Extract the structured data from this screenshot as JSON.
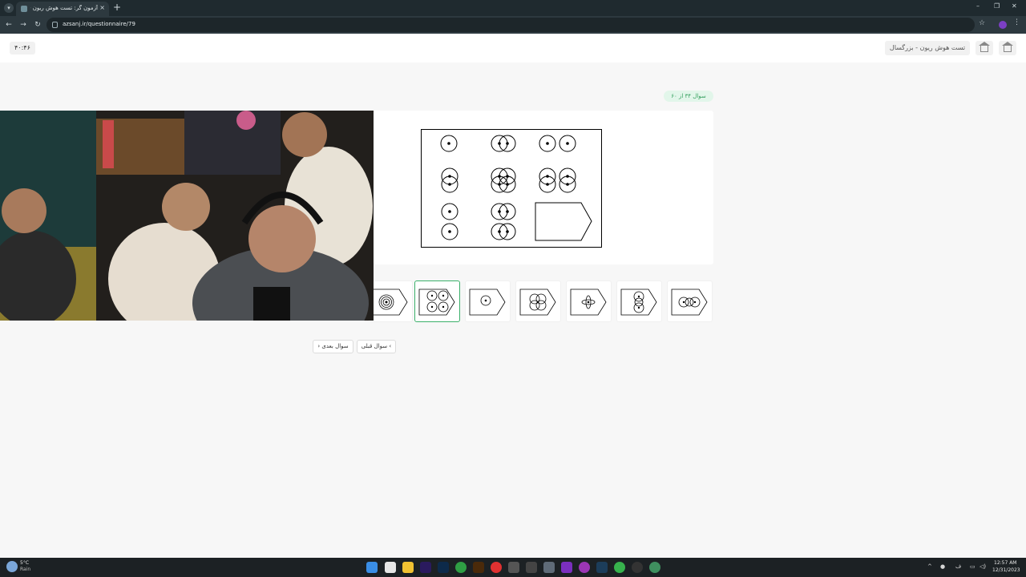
{
  "browser": {
    "tab_title": "آزمون گر: تست هوش ریون - بزرگسال",
    "tab_close": "×",
    "new_tab": "+",
    "url": "azsanj.ir/questionnaire/79",
    "minimize": "–",
    "restore": "❐",
    "close": "✕"
  },
  "header": {
    "timer": "۴۰:۴۶",
    "test_title": "تست هوش ریون - بزرگسال"
  },
  "question": {
    "progress": "سوال ۳۴ از ۶۰"
  },
  "navigation": {
    "next_label": "سوال بعدی",
    "prev_label": "سوال قبلی"
  },
  "options": {
    "selected_index": 1
  },
  "taskbar": {
    "temperature": "5°C",
    "weather": "Rain",
    "time": "12:57 AM",
    "date": "12/31/2023"
  },
  "colors": {
    "accent_green": "#3bb06a",
    "pill_bg": "#e2f6ea",
    "browser_chrome": "#2d393f"
  }
}
